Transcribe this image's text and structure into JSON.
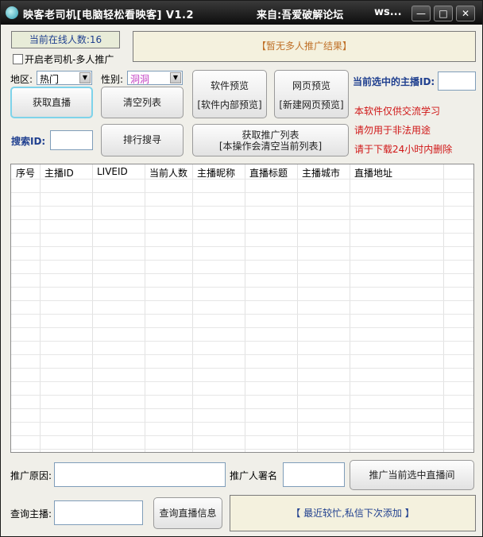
{
  "titlebar": {
    "title": "映客老司机[电脑轻松看映客] V1.2",
    "source": "来自:吾爱破解论坛",
    "extra": "ws...",
    "minimize": "—",
    "maximize": "□",
    "close": "✕"
  },
  "status": {
    "online_label": "当前在线人数:16",
    "banner": "【暂无多人推广结果】",
    "multi_promo_label": "开启老司机-多人推广"
  },
  "filters": {
    "region_label": "地区:",
    "region_value": "热门",
    "gender_label": "性别:",
    "gender_value": "洞洞"
  },
  "buttons": {
    "get_live": "获取直播",
    "clear_list": "清空列表",
    "soft_preview_line1": "软件预览",
    "soft_preview_line2": "[软件内部预览]",
    "web_preview_line1": "网页预览",
    "web_preview_line2": "[新建网页预览]",
    "rank_search": "排行搜寻",
    "get_promo_line1": "获取推广列表",
    "get_promo_line2": "[本操作会清空当前列表]",
    "promote_selected": "推广当前选中直播间",
    "query_info": "查询直播信息"
  },
  "selected": {
    "label": "当前选中的主播ID:",
    "value": ""
  },
  "search": {
    "label": "搜索ID:",
    "value": ""
  },
  "notices": {
    "line1": "本软件仅供交流学习",
    "line2": "请勿用于非法用途",
    "line3": "请于下载24小时内删除"
  },
  "table": {
    "columns": [
      "序号",
      "主播ID",
      "LIVEID",
      "当前人数",
      "主播昵称",
      "直播标题",
      "主播城市",
      "直播地址"
    ],
    "rows": []
  },
  "promo_form": {
    "reason_label": "推广原因:",
    "reason_value": "",
    "signer_label": "推广人署名",
    "signer_value": ""
  },
  "query": {
    "label": "查询主播:",
    "value": ""
  },
  "footer": {
    "message": "【 最近较忙,私信下次添加 】"
  },
  "colors": {
    "title_bg": "#1a1a1a",
    "notice_red": "#d01616",
    "label_blue": "#1f3f8f",
    "banner_text": "#c0722a"
  }
}
